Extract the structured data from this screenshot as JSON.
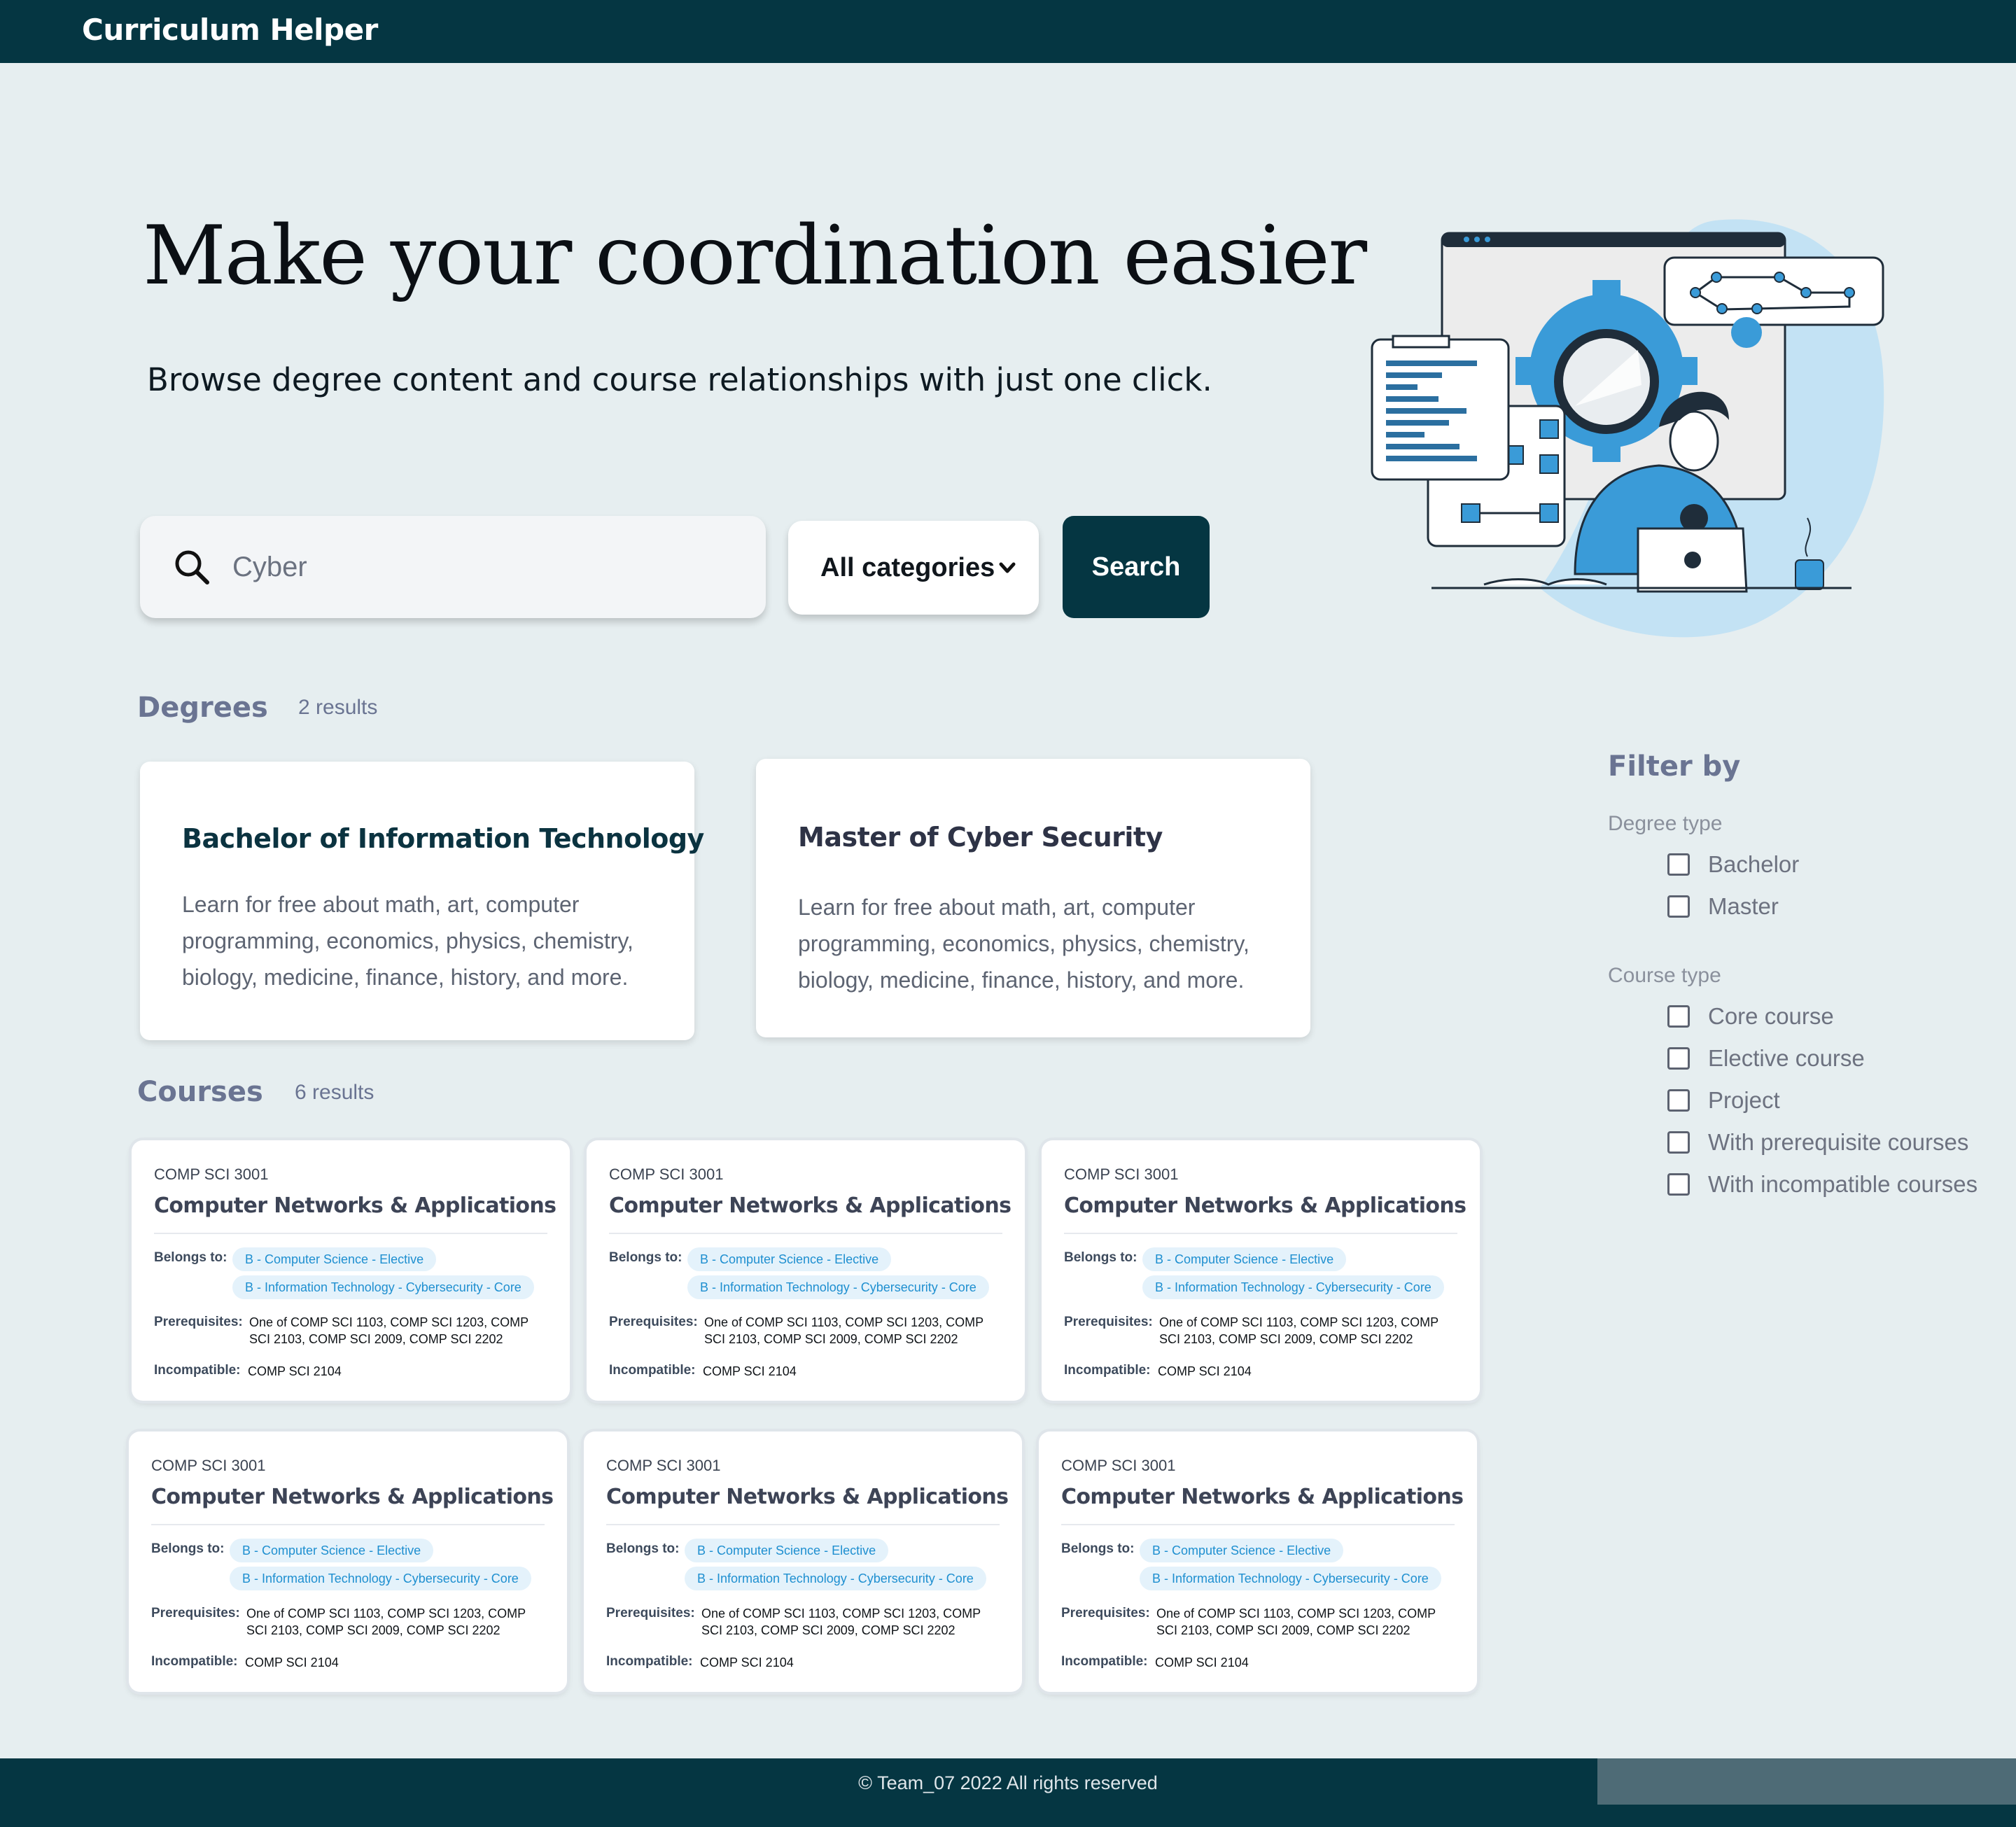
{
  "header": {
    "brand": "Curriculum Helper"
  },
  "hero": {
    "title": "Make your coordination easier",
    "subtitle": "Browse degree content and course relationships with just one click."
  },
  "search": {
    "value": "Cyber",
    "placeholder": "Cyber",
    "category": "All categories",
    "button_label": "Search"
  },
  "degrees": {
    "title": "Degrees",
    "count": "2 results",
    "items": [
      {
        "title": "Bachelor of Information Technology",
        "description": "Learn for free about math, art, computer programming, economics, physics, chemistry, biology, medicine, finance, history, and more.",
        "title_color": "#0b3340"
      },
      {
        "title": "Master of Cyber Security",
        "description": "Learn for free about math, art, computer programming, economics, physics, chemistry, biology, medicine, finance, history, and more.",
        "title_color": "#2e3346"
      }
    ]
  },
  "courses": {
    "title": "Courses",
    "count": "6 results",
    "labels": {
      "belongs": "Belongs to:",
      "prereq": "Prerequisites:",
      "incompat": "Incompatible:"
    },
    "items": [
      {
        "code": "COMP SCI 3001",
        "title": "Computer Networks & Applications",
        "tags": [
          "B - Computer Science - Elective",
          "B - Information Technology - Cybersecurity - Core"
        ],
        "prerequisites": "One of COMP SCI 1103, COMP SCI 1203, COMP SCI 2103, COMP SCI 2009, COMP SCI 2202",
        "incompatible": "COMP SCI 2104"
      },
      {
        "code": "COMP SCI 3001",
        "title": "Computer Networks & Applications",
        "tags": [
          "B - Computer Science - Elective",
          "B - Information Technology - Cybersecurity - Core"
        ],
        "prerequisites": "One of COMP SCI 1103, COMP SCI 1203, COMP SCI 2103, COMP SCI 2009, COMP SCI 2202",
        "incompatible": "COMP SCI 2104"
      },
      {
        "code": "COMP SCI 3001",
        "title": "Computer Networks & Applications",
        "tags": [
          "B - Computer Science - Elective",
          "B - Information Technology - Cybersecurity - Core"
        ],
        "prerequisites": "One of COMP SCI 1103, COMP SCI 1203, COMP SCI 2103, COMP SCI 2009, COMP SCI 2202",
        "incompatible": "COMP SCI 2104"
      },
      {
        "code": "COMP SCI 3001",
        "title": "Computer Networks & Applications",
        "tags": [
          "B - Computer Science - Elective",
          "B - Information Technology - Cybersecurity - Core"
        ],
        "prerequisites": "One of COMP SCI 1103, COMP SCI 1203, COMP SCI 2103, COMP SCI 2009, COMP SCI 2202",
        "incompatible": "COMP SCI 2104"
      },
      {
        "code": "COMP SCI 3001",
        "title": "Computer Networks & Applications",
        "tags": [
          "B - Computer Science - Elective",
          "B - Information Technology - Cybersecurity - Core"
        ],
        "prerequisites": "One of COMP SCI 1103, COMP SCI 1203, COMP SCI 2103, COMP SCI 2009, COMP SCI 2202",
        "incompatible": "COMP SCI 2104"
      },
      {
        "code": "COMP SCI 3001",
        "title": "Computer Networks & Applications",
        "tags": [
          "B - Computer Science - Elective",
          "B - Information Technology - Cybersecurity - Core"
        ],
        "prerequisites": "One of COMP SCI 1103, COMP SCI 1203, COMP SCI 2103, COMP SCI 2009, COMP SCI 2202",
        "incompatible": "COMP SCI 2104"
      }
    ]
  },
  "filter": {
    "title": "Filter by",
    "degree_type": {
      "label": "Degree type",
      "options": [
        "Bachelor",
        "Master"
      ]
    },
    "course_type": {
      "label": "Course type",
      "options": [
        "Core course",
        "Elective course",
        "Project",
        "With prerequisite courses",
        "With incompatible courses"
      ]
    }
  },
  "footer": {
    "text": "© Team_07   2022   All rights reserved"
  },
  "colors": {
    "primary": "#053642",
    "background": "#e6eef0",
    "tag_bg": "#e4f2fb",
    "tag_text": "#1e8fd0",
    "illustration_blue": "#3a9bd8"
  }
}
